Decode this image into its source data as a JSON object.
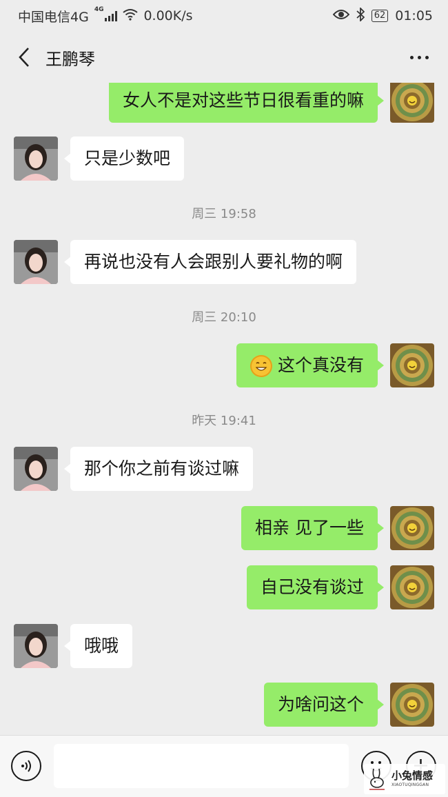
{
  "status_bar": {
    "carrier": "中国电信4G",
    "network_badge": "4G",
    "speed": "0.00K/s",
    "battery": "62",
    "time": "01:05",
    "icons": [
      "signal-icon",
      "wifi-icon",
      "eye-icon",
      "bluetooth-icon",
      "battery-icon"
    ]
  },
  "navbar": {
    "title": "王鹏琴",
    "back_icon": "chevron-left-icon",
    "more_icon": "more-dots-icon"
  },
  "messages": [
    {
      "type": "out",
      "text": "女人不是对这些节日很看重的嘛"
    },
    {
      "type": "in",
      "text": "只是少数吧"
    },
    {
      "type": "time",
      "text": "周三 19:58"
    },
    {
      "type": "in",
      "text": "再说也没有人会跟别人要礼物的啊"
    },
    {
      "type": "time",
      "text": "周三 20:10"
    },
    {
      "type": "out",
      "text": "这个真没有",
      "emoji": "grin-emoji-icon"
    },
    {
      "type": "time",
      "text": "昨天 19:41"
    },
    {
      "type": "in",
      "text": "那个你之前有谈过嘛"
    },
    {
      "type": "out",
      "text": "相亲 见了一些"
    },
    {
      "type": "out",
      "text": "自己没有谈过"
    },
    {
      "type": "in",
      "text": "哦哦"
    },
    {
      "type": "out",
      "text": "为啥问这个"
    }
  ],
  "input_bar": {
    "placeholder": "",
    "value": "",
    "icons": [
      "voice-icon",
      "emoji-icon",
      "plus-icon"
    ]
  },
  "watermark": {
    "main": "小兔情感",
    "sub": "XIAOTUQINGGAN"
  },
  "colors": {
    "background": "#ededed",
    "bubble_out": "#95ec69",
    "bubble_in": "#ffffff",
    "timestamp": "#8a8a8a"
  }
}
